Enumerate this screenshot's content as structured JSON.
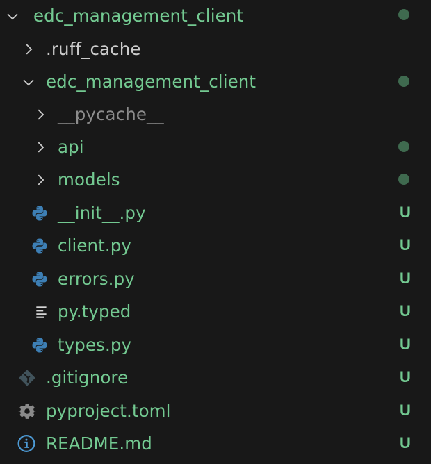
{
  "colors": {
    "background": "#181818",
    "untracked": "#73c991",
    "modified_dot": "#3f6a4f",
    "ignored": "#8c8c8c"
  },
  "items": [
    {
      "label": "edc_management_client",
      "kind": "folder",
      "expanded": true,
      "status": "dot"
    },
    {
      "label": ".ruff_cache",
      "kind": "folder",
      "expanded": false,
      "status": ""
    },
    {
      "label": "edc_management_client",
      "kind": "folder",
      "expanded": true,
      "status": "dot"
    },
    {
      "label": "__pycache__",
      "kind": "folder",
      "expanded": false,
      "status": ""
    },
    {
      "label": "api",
      "kind": "folder",
      "expanded": false,
      "status": "dot"
    },
    {
      "label": "models",
      "kind": "folder",
      "expanded": false,
      "status": "dot"
    },
    {
      "label": "__init__.py",
      "kind": "python-file",
      "icon": "python-icon",
      "status": "U"
    },
    {
      "label": "client.py",
      "kind": "python-file",
      "icon": "python-icon",
      "status": "U"
    },
    {
      "label": "errors.py",
      "kind": "python-file",
      "icon": "python-icon",
      "status": "U"
    },
    {
      "label": "py.typed",
      "kind": "text-file",
      "icon": "text-lines-icon",
      "status": "U"
    },
    {
      "label": "types.py",
      "kind": "python-file",
      "icon": "python-icon",
      "status": "U"
    },
    {
      "label": ".gitignore",
      "kind": "git-file",
      "icon": "git-icon",
      "status": "U"
    },
    {
      "label": "pyproject.toml",
      "kind": "config-file",
      "icon": "gear-icon",
      "status": "U"
    },
    {
      "label": "README.md",
      "kind": "info-file",
      "icon": "info-icon",
      "status": "U"
    }
  ]
}
